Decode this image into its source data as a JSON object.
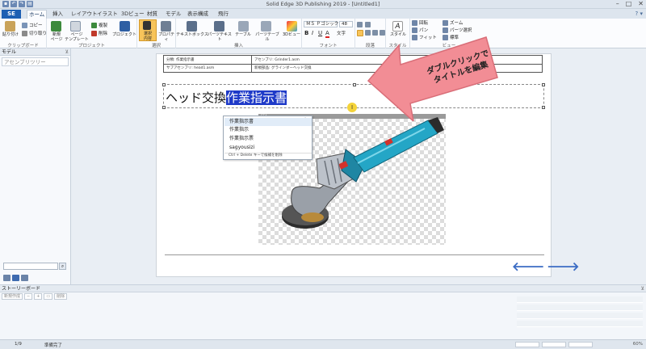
{
  "app": {
    "title": "Solid Edge 3D Publishing 2019 - [Untitled1]",
    "button_label": "SE"
  },
  "window_controls": [
    "–",
    "□",
    "✕"
  ],
  "tabs": [
    {
      "label": "ホーム",
      "active": true
    },
    {
      "label": "挿入",
      "active": false
    },
    {
      "label": "レイアウト",
      "active": false
    },
    {
      "label": "イラスト",
      "active": false
    },
    {
      "label": "3Dビュー",
      "active": false
    },
    {
      "label": "材質",
      "active": false
    },
    {
      "label": "モデル",
      "active": false
    },
    {
      "label": "表示構成",
      "active": false
    },
    {
      "label": "飛行",
      "active": false
    }
  ],
  "tabrow_right": "? ▾",
  "ribbon": {
    "clipboard": {
      "label": "クリップボード",
      "paste": "貼り付け",
      "copy": "コピー",
      "cut": "切り取り"
    },
    "project": {
      "label": "プロジェクト",
      "new_page": "新規\nページ",
      "page_template": "ページ\nテンプレート",
      "duplicate": "複製",
      "delete": "削除",
      "project": "プロジェクト"
    },
    "select": {
      "label": "選択",
      "select_tool": "選択\n内容",
      "properties": "プロパティ"
    },
    "insert": {
      "label": "挿入",
      "textbox": "テキストボックス",
      "parts_text": "パーツテキスト",
      "table": "テーブル",
      "parts_table": "パーツテーブル",
      "view3d": "3Dビュー"
    },
    "font": {
      "label": "フォント",
      "font_name": "ＭＳ Ｐゴシック",
      "font_size": "48",
      "char_label": "文字"
    },
    "paragraph": {
      "label": "段落"
    },
    "style": {
      "label": "スタイル",
      "style_btn": "スタイル"
    },
    "view": {
      "label": "ビュー",
      "rotate": "回転",
      "pan": "パン",
      "zoom": "ズーム",
      "parts_select": "パーツ選択",
      "standard": "標準",
      "fit": "フィット"
    }
  },
  "left_pane": {
    "header": "モデル",
    "assembly": "アセンブリツリー"
  },
  "document": {
    "header_cells": {
      "r1c1": "分類: 作業指示書",
      "r1c2": "アセンブリ: Grinder1.asm",
      "r2c1": "サブアセンブリ: head1.asm",
      "r2c2": "新規部品: グラインダーヘッド交換"
    },
    "title_plain": "ヘッド交換",
    "title_selected": "作業指示書"
  },
  "ime": {
    "candidates": [
      "作業指示書",
      "作業指示",
      "作業指示票",
      "sagyousizi"
    ],
    "hint": "Ctrl + Delete キーで候補を削除",
    "icons": "✕ 🔍"
  },
  "image_bar": "SE4",
  "callout": {
    "text": "ダブルクリックで\nタイトルを編集"
  },
  "cursor_glyph": "I",
  "nav": {
    "back": "🡐",
    "forward": "🡒"
  },
  "storyboard": {
    "header": "ストーリーボード",
    "buttons": [
      "新規作成",
      "−",
      "+",
      "▭",
      "削除"
    ]
  },
  "status": {
    "page": "1/9",
    "state": "準備完了",
    "zoom": "60%"
  },
  "colors": {
    "accent": "#1d5fb3",
    "selection": "#1e3ac8",
    "callout_fill": "#f28d95",
    "callout_stroke": "#d96e78",
    "arrow_blue": "#3b6cc4"
  }
}
